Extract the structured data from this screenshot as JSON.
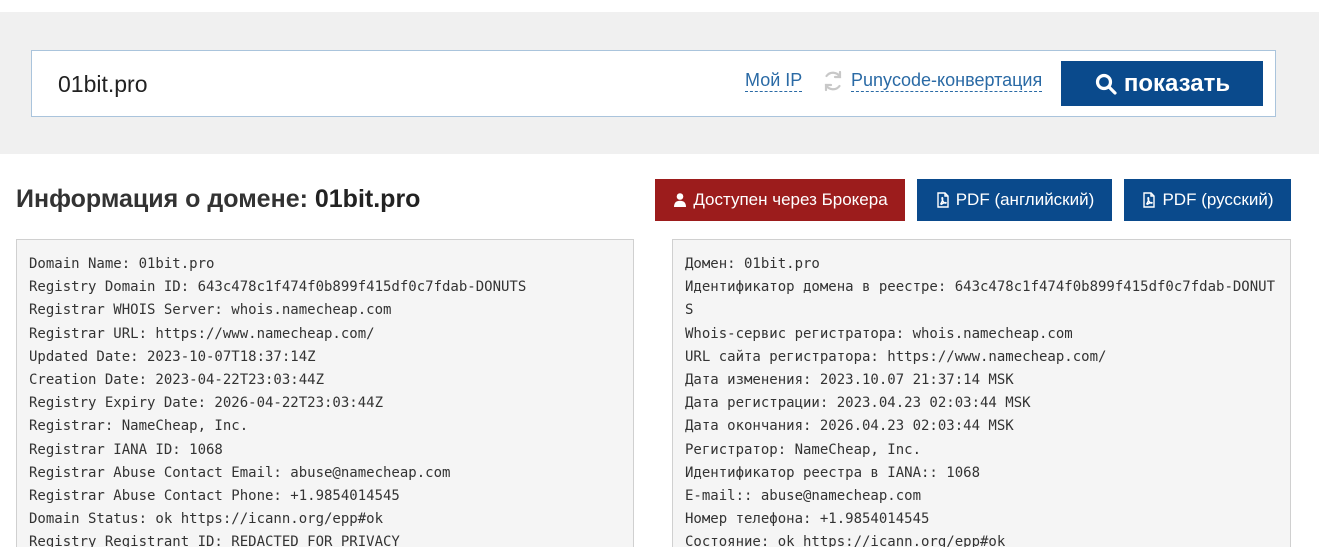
{
  "search": {
    "value": "01bit.pro",
    "my_ip_label": "Мой IP",
    "punycode_label": "Punycode-конвертация",
    "show_label": "показать"
  },
  "header": {
    "title_prefix": "Информация о домене: ",
    "domain": "01bit.pro"
  },
  "actions": {
    "broker_label": "Доступен через Брокера",
    "pdf_en_label": "PDF (английский)",
    "pdf_ru_label": "PDF (русский)"
  },
  "colors": {
    "primary": "#0a4a8c",
    "danger": "#9c1c1c",
    "link": "#2a6aa5"
  },
  "whois_en": [
    "Domain Name: 01bit.pro",
    "Registry Domain ID: 643c478c1f474f0b899f415df0c7fdab-DONUTS",
    "Registrar WHOIS Server: whois.namecheap.com",
    "Registrar URL: https://www.namecheap.com/",
    "Updated Date: 2023-10-07T18:37:14Z",
    "Creation Date: 2023-04-22T23:03:44Z",
    "Registry Expiry Date: 2026-04-22T23:03:44Z",
    "Registrar: NameCheap, Inc.",
    "Registrar IANA ID: 1068",
    "Registrar Abuse Contact Email: abuse@namecheap.com",
    "Registrar Abuse Contact Phone: +1.9854014545",
    "Domain Status: ok https://icann.org/epp#ok",
    "Registry Registrant ID: REDACTED FOR PRIVACY"
  ],
  "whois_ru": [
    "Домен: 01bit.pro",
    "Идентификатор домена в реестре: 643c478c1f474f0b899f415df0c7fdab-DONUTS",
    "Whois-сервис регистратора: whois.namecheap.com",
    "URL сайта регистратора: https://www.namecheap.com/",
    "Дата изменения: 2023.10.07 21:37:14 MSK",
    "Дата регистрации: 2023.04.23 02:03:44 MSK",
    "Дата окончания: 2026.04.23 02:03:44 MSK",
    "Регистратор: NameCheap, Inc.",
    "Идентификатор реестра в IANA:: 1068",
    "E-mail:: abuse@namecheap.com",
    "Номер телефона: +1.9854014545",
    "Состояние: ok https://icann.org/epp#ok"
  ]
}
